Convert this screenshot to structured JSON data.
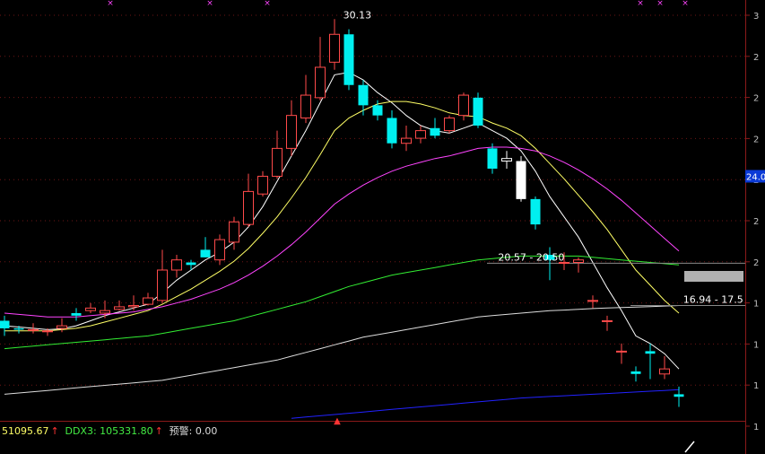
{
  "chart_data": {
    "type": "candlestick",
    "ylim": [
      14.6,
      30.6
    ],
    "x": [
      1,
      2,
      3,
      4,
      5,
      6,
      7,
      8,
      9,
      10,
      11,
      12,
      13,
      14,
      15,
      16,
      17,
      18,
      19,
      20,
      21,
      22,
      23,
      24,
      25,
      26,
      27,
      28,
      29,
      30,
      31,
      32,
      33,
      34,
      35,
      36,
      37,
      38,
      39,
      40,
      41,
      42,
      43,
      44,
      45,
      46,
      47,
      48
    ],
    "open": [
      18.3,
      18.0,
      17.95,
      17.9,
      18.0,
      18.6,
      18.7,
      18.6,
      18.75,
      18.85,
      18.95,
      19.1,
      20.3,
      20.6,
      21.1,
      20.7,
      21.4,
      22.1,
      23.3,
      24.0,
      25.1,
      26.3,
      27.1,
      28.5,
      29.6,
      27.6,
      26.8,
      26.3,
      25.3,
      25.5,
      25.9,
      25.8,
      26.4,
      27.1,
      25.1,
      24.6,
      24.6,
      23.1,
      20.9,
      20.6,
      20.6,
      19.1,
      18.3,
      17.1,
      16.3,
      17.1,
      16.2,
      15.4
    ],
    "close": [
      18.0,
      17.95,
      17.95,
      17.9,
      18.1,
      18.5,
      18.8,
      18.7,
      18.85,
      18.9,
      19.2,
      20.3,
      20.7,
      20.5,
      20.8,
      21.5,
      22.2,
      23.4,
      24.0,
      25.1,
      26.4,
      27.2,
      28.3,
      29.6,
      27.6,
      26.8,
      26.4,
      25.3,
      25.5,
      25.8,
      25.6,
      26.3,
      27.2,
      26.0,
      24.3,
      24.7,
      23.1,
      22.1,
      20.7,
      20.6,
      20.7,
      19.1,
      18.3,
      17.1,
      16.2,
      17.0,
      16.4,
      15.3
    ],
    "high": [
      18.5,
      18.1,
      18.2,
      18.0,
      18.4,
      18.8,
      19.0,
      19.1,
      19.1,
      19.3,
      19.4,
      21.1,
      20.9,
      20.7,
      21.6,
      21.7,
      22.4,
      24.1,
      24.2,
      25.8,
      27.0,
      28.0,
      29.5,
      30.2,
      29.8,
      27.8,
      27.0,
      26.6,
      26.0,
      26.0,
      26.3,
      26.4,
      27.3,
      27.3,
      25.3,
      25.0,
      24.8,
      23.2,
      21.2,
      21.0,
      20.8,
      19.3,
      18.5,
      17.4,
      16.5,
      17.4,
      16.9,
      15.7
    ],
    "low": [
      17.7,
      17.8,
      17.8,
      17.7,
      17.85,
      18.3,
      18.6,
      18.4,
      18.7,
      18.7,
      18.9,
      19.0,
      20.0,
      20.3,
      20.8,
      20.5,
      21.1,
      22.0,
      23.2,
      23.9,
      24.8,
      26.1,
      27.0,
      28.2,
      27.4,
      26.4,
      26.2,
      25.1,
      25.0,
      25.3,
      25.5,
      25.7,
      26.2,
      25.9,
      24.1,
      24.3,
      23.0,
      21.9,
      19.9,
      20.3,
      20.2,
      18.8,
      17.9,
      16.6,
      15.9,
      16.0,
      16.0,
      14.9
    ],
    "highlight_indices": [
      35,
      36
    ],
    "ma_lines": [
      {
        "color": "#ffffff",
        "values": [
          18.1,
          18.05,
          18.0,
          17.95,
          17.98,
          18.1,
          18.3,
          18.5,
          18.65,
          18.8,
          18.95,
          19.4,
          19.9,
          20.3,
          20.7,
          21.0,
          21.4,
          22.0,
          22.8,
          23.8,
          24.8,
          25.8,
          26.9,
          28.0,
          28.1,
          27.8,
          27.3,
          26.9,
          26.4,
          26.0,
          25.8,
          25.7,
          25.9,
          26.1,
          25.8,
          25.5,
          25.0,
          24.2,
          23.2,
          22.4,
          21.6,
          20.6,
          19.6,
          18.7,
          17.7,
          17.4,
          17.0,
          16.4
        ]
      },
      {
        "color": "#ffff66",
        "values": [
          17.9,
          17.9,
          17.9,
          17.9,
          17.95,
          18.0,
          18.1,
          18.25,
          18.4,
          18.55,
          18.7,
          18.95,
          19.25,
          19.55,
          19.9,
          20.25,
          20.65,
          21.15,
          21.75,
          22.4,
          23.15,
          23.95,
          24.85,
          25.8,
          26.3,
          26.6,
          26.85,
          26.95,
          26.95,
          26.85,
          26.7,
          26.5,
          26.4,
          26.35,
          26.1,
          25.9,
          25.6,
          25.1,
          24.5,
          23.9,
          23.25,
          22.6,
          21.9,
          21.1,
          20.3,
          19.7,
          19.1,
          18.6
        ]
      },
      {
        "color": "#ff44ff",
        "values": [
          18.6,
          18.55,
          18.5,
          18.45,
          18.45,
          18.45,
          18.5,
          18.55,
          18.6,
          18.65,
          18.75,
          18.85,
          19.0,
          19.15,
          19.35,
          19.55,
          19.8,
          20.1,
          20.45,
          20.85,
          21.3,
          21.8,
          22.35,
          22.9,
          23.3,
          23.65,
          23.95,
          24.2,
          24.4,
          24.55,
          24.7,
          24.8,
          24.95,
          25.1,
          25.15,
          25.15,
          25.1,
          25.0,
          24.8,
          24.55,
          24.25,
          23.9,
          23.5,
          23.05,
          22.55,
          22.05,
          21.55,
          21.05
        ]
      },
      {
        "color": "#33ee33",
        "values": [
          17.2,
          17.25,
          17.3,
          17.35,
          17.4,
          17.45,
          17.5,
          17.55,
          17.6,
          17.65,
          17.7,
          17.8,
          17.9,
          18.0,
          18.1,
          18.2,
          18.3,
          18.45,
          18.6,
          18.75,
          18.9,
          19.05,
          19.25,
          19.45,
          19.65,
          19.8,
          19.95,
          20.1,
          20.2,
          20.3,
          20.4,
          20.5,
          20.6,
          20.7,
          20.75,
          20.8,
          20.85,
          20.85,
          20.85,
          20.85,
          20.85,
          20.8,
          20.75,
          20.7,
          20.65,
          20.6,
          20.55,
          20.5
        ]
      },
      {
        "color": "#dddddd",
        "values": [
          15.4,
          15.45,
          15.5,
          15.55,
          15.6,
          15.65,
          15.7,
          15.75,
          15.8,
          15.85,
          15.9,
          15.95,
          16.05,
          16.15,
          16.25,
          16.35,
          16.45,
          16.55,
          16.65,
          16.75,
          16.9,
          17.05,
          17.2,
          17.35,
          17.5,
          17.65,
          17.75,
          17.85,
          17.95,
          18.05,
          18.15,
          18.25,
          18.35,
          18.45,
          18.5,
          18.55,
          18.6,
          18.65,
          18.7,
          18.72,
          18.75,
          18.78,
          18.8,
          18.82,
          18.84,
          18.86,
          18.88,
          18.9
        ]
      },
      {
        "color": "#2222ff",
        "start_index": 20,
        "values": [
          14.45,
          14.5,
          14.55,
          14.6,
          14.65,
          14.7,
          14.75,
          14.8,
          14.85,
          14.9,
          14.95,
          15.0,
          15.05,
          15.1,
          15.15,
          15.2,
          15.25,
          15.28,
          15.31,
          15.34,
          15.37,
          15.4,
          15.43,
          15.46,
          15.49,
          15.52,
          15.55,
          15.58
        ]
      }
    ],
    "hlines": [
      {
        "y": 20.57,
        "from_index": 34,
        "color": "#888888"
      },
      {
        "y": 18.9,
        "from_index": 44,
        "color": "#888888"
      }
    ],
    "annotations": [
      {
        "text": "30.13",
        "x_index": 23.6,
        "y": 30.13
      },
      {
        "text": "20.57 - 20.50",
        "x_index": 34.4,
        "y": 20.57
      },
      {
        "text": "16.94 - 17.5",
        "x_index": 47.3,
        "y": 18.9
      }
    ],
    "y_axis_tag": {
      "text": "24.0",
      "y": 24.0
    },
    "y_tick_labels": [
      "3",
      "2",
      "2",
      "2",
      "2",
      "2",
      "2",
      "1",
      "1",
      "1",
      "1",
      "4"
    ],
    "indicators": [
      {
        "text": "51095.67",
        "color": "#ffff66",
        "arrow": "↑"
      },
      {
        "text": "DDX3: 105331.80",
        "color": "#44ee44",
        "arrow": "↑"
      },
      {
        "text": "预警: 0.00",
        "color": "#dddddd",
        "arrow": ""
      }
    ]
  }
}
